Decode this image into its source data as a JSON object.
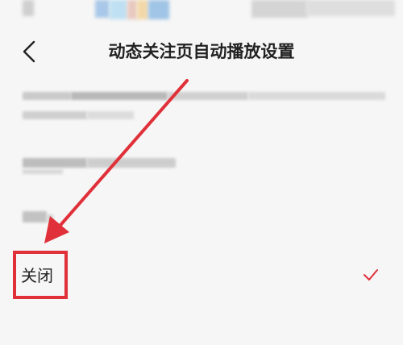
{
  "header": {
    "title": "动态关注页自动播放设置",
    "back_icon": "chevron-left-icon"
  },
  "options": [
    {
      "label": "",
      "selected": false
    },
    {
      "label": "",
      "selected": false
    },
    {
      "label": "",
      "selected": false
    },
    {
      "label": "关闭",
      "selected": true,
      "check_icon": "checkmark-icon"
    }
  ],
  "annotation": {
    "arrow_color": "#e0303a",
    "box_color": "#e0303a"
  },
  "colors": {
    "background": "#f6f6f6",
    "text": "#222222",
    "accent": "#e0303a"
  }
}
